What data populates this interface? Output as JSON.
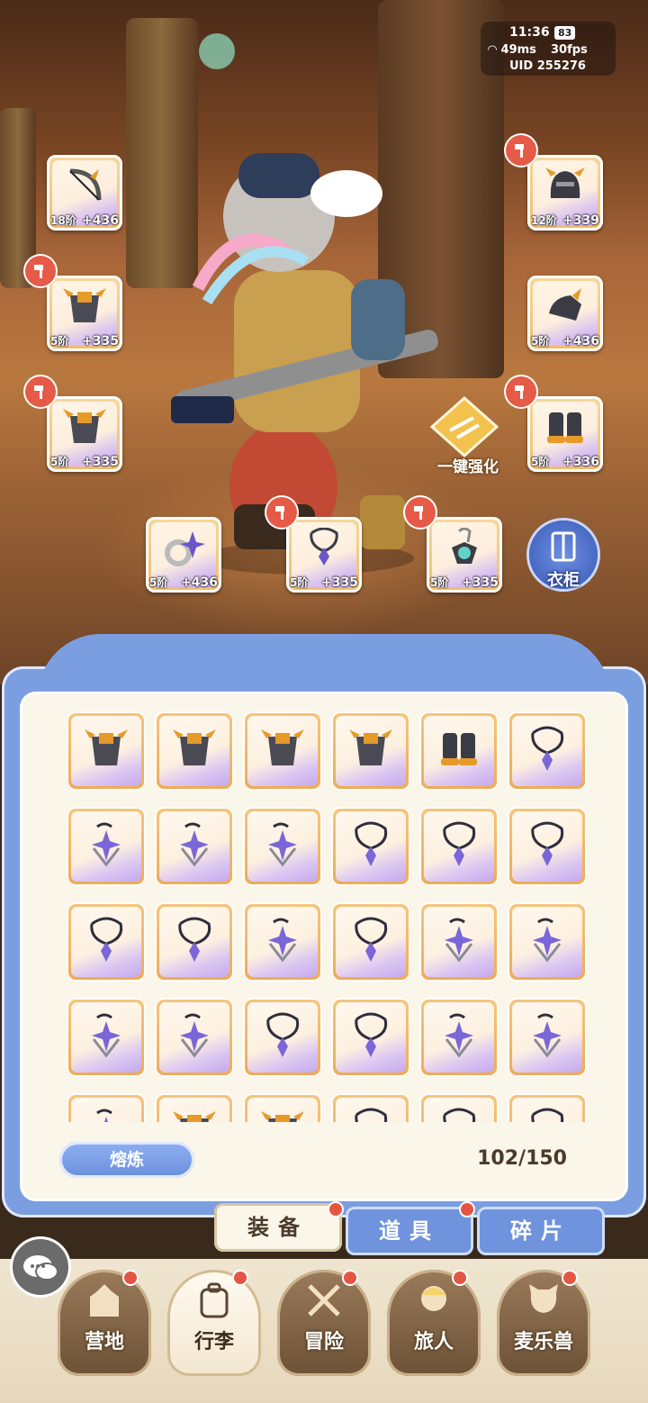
{
  "status": {
    "time": "11:36",
    "battery": "83",
    "ping": "49ms",
    "fps": "30fps",
    "uid": "UID 255276"
  },
  "equipped": {
    "bow": {
      "tier": "18阶",
      "plus": "+436"
    },
    "helmet": {
      "tier": "12阶",
      "plus": "+339"
    },
    "armor_left": {
      "tier": "5阶",
      "plus": "+335"
    },
    "gauntlet": {
      "tier": "5阶",
      "plus": "+436"
    },
    "armor_left2": {
      "tier": "5阶",
      "plus": "+335"
    },
    "boots": {
      "tier": "5阶",
      "plus": "+336"
    },
    "ring": {
      "tier": "5阶",
      "plus": "+436"
    },
    "necklace": {
      "tier": "5阶",
      "plus": "+335"
    },
    "amulet": {
      "tier": "5阶",
      "plus": "+335"
    }
  },
  "actions": {
    "auto_enhance": "一键强化",
    "wardrobe": "衣柜"
  },
  "inventory": {
    "rows": [
      [
        "armor",
        "armor",
        "armor",
        "armor",
        "boots",
        "necklace-loop"
      ],
      [
        "necklace-star",
        "necklace-star",
        "necklace-star",
        "necklace-loop",
        "necklace-loop",
        "necklace-loop"
      ],
      [
        "necklace-loop",
        "necklace-loop",
        "necklace-star",
        "necklace-loop",
        "necklace-star",
        "necklace-star"
      ],
      [
        "necklace-star",
        "necklace-star",
        "necklace-loop",
        "necklace-loop",
        "necklace-star",
        "necklace-star"
      ],
      [
        "necklace-star",
        "armor",
        "armor",
        "necklace-loop",
        "necklace-loop",
        "necklace-loop"
      ]
    ],
    "smelt_label": "熔炼",
    "count": "102/150"
  },
  "tabs": [
    {
      "label": "装备",
      "active": true
    },
    {
      "label": "道具",
      "active": false
    },
    {
      "label": "碎片",
      "active": false
    }
  ],
  "nav": [
    {
      "label": "营地"
    },
    {
      "label": "行李"
    },
    {
      "label": "冒险"
    },
    {
      "label": "旅人"
    },
    {
      "label": "麦乐兽"
    }
  ],
  "colors": {
    "accent": "#7b9ee0",
    "badge": "#e55544",
    "slot_gold": "#f1bc6b",
    "rare_purple": "#c4a3ea"
  }
}
